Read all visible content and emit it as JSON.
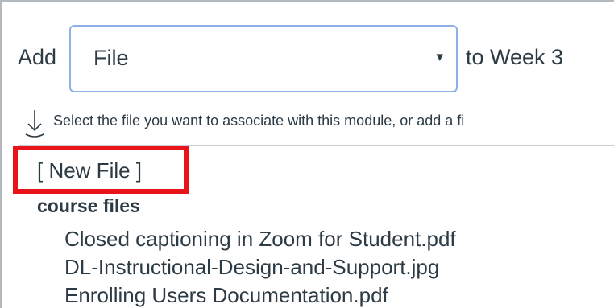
{
  "add_item": {
    "add_label": "Add",
    "type_select": {
      "selected": "File",
      "arrow_glyph": "▾"
    },
    "target_label": "to Week 3"
  },
  "upload_hint": {
    "icon": "upload-arrow-icon",
    "text": "Select the file you want to associate with this module, or add a fi"
  },
  "file_picker": {
    "new_file_label": "[ New File ]",
    "folder_label": "course files",
    "files": [
      "Closed captioning in Zoom for Student.pdf",
      "DL-Instructional-Design-and-Support.jpg",
      "Enrolling Users Documentation.pdf"
    ]
  },
  "colors": {
    "text": "#2d3b45",
    "focus_border": "#8fb1e8",
    "highlight": "#e8141a"
  }
}
